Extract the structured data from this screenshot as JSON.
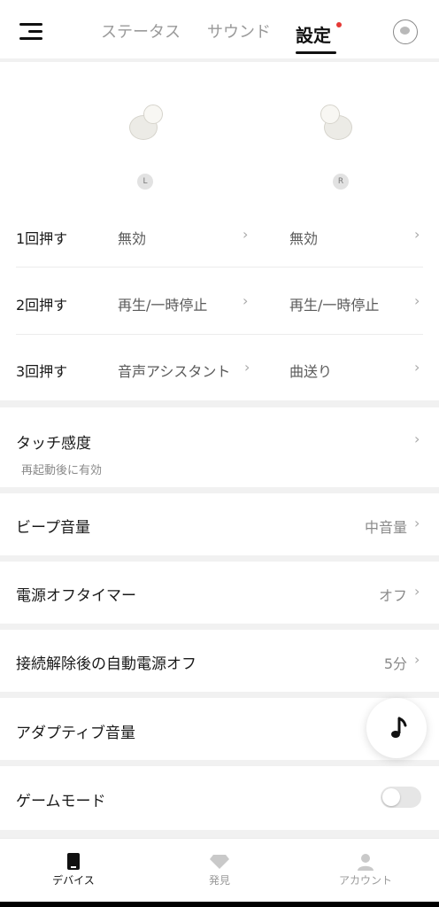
{
  "header": {
    "tabs": [
      {
        "label": "ステータス",
        "active": false
      },
      {
        "label": "サウンド",
        "active": false
      },
      {
        "label": "設定",
        "active": true,
        "has_notification_dot": true
      }
    ],
    "menu_icon": "menu-icon",
    "avatar_icon": "device-avatar-icon",
    "notification_color": "#e53935"
  },
  "earbuds": {
    "left_badge": "L",
    "right_badge": "R",
    "icon": "earbud-icon"
  },
  "controls": {
    "rows": [
      {
        "label": "1回押す",
        "left_value": "無効",
        "right_value": "無効"
      },
      {
        "label": "2回押す",
        "left_value": "再生/一時停止",
        "right_value": "再生/一時停止"
      },
      {
        "label": "3回押す",
        "left_value": "音声アシスタント",
        "right_value": "曲送り"
      }
    ]
  },
  "settings": {
    "touch_sensitivity": {
      "title": "タッチ感度",
      "subtitle": "再起動後に有効"
    },
    "beep_volume": {
      "title": "ビープ音量",
      "value": "中音量"
    },
    "power_off_timer": {
      "title": "電源オフタイマー",
      "value": "オフ"
    },
    "auto_power_off": {
      "title": "接続解除後の自動電源オフ",
      "value": "5分"
    },
    "adaptive_volume": {
      "title": "アダプティブ音量"
    },
    "game_mode": {
      "title": "ゲームモード",
      "enabled": false
    }
  },
  "fab": {
    "icon": "music-note-icon"
  },
  "bottom_nav": {
    "items": [
      {
        "label": "デバイス",
        "icon": "device-icon",
        "active": true
      },
      {
        "label": "発見",
        "icon": "diamond-icon",
        "active": false
      },
      {
        "label": "アカウント",
        "icon": "person-icon",
        "active": false
      }
    ]
  },
  "colors": {
    "accent": "#111111",
    "notification": "#e53935",
    "muted": "#9a9a9a"
  }
}
